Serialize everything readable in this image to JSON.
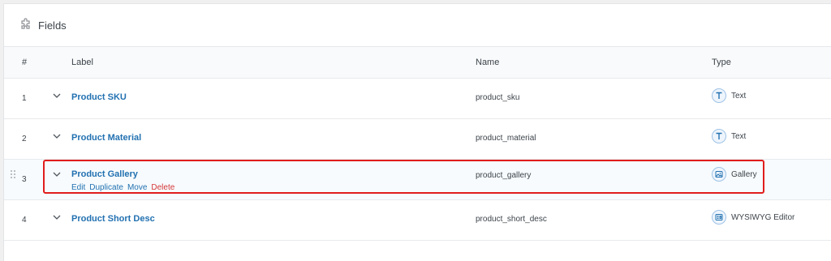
{
  "panel": {
    "title": "Fields",
    "icon": "puzzle-icon"
  },
  "table": {
    "columns": [
      "#",
      "Label",
      "Name",
      "Type"
    ],
    "rows": [
      {
        "num": "1",
        "label": "Product SKU",
        "name": "product_sku",
        "type": "Text",
        "type_icon": "text-type-icon"
      },
      {
        "num": "2",
        "label": "Product Material",
        "name": "product_material",
        "type": "Text",
        "type_icon": "text-type-icon"
      },
      {
        "num": "3",
        "label": "Product Gallery",
        "name": "product_gallery",
        "type": "Gallery",
        "type_icon": "gallery-type-icon",
        "actions": {
          "edit": "Edit",
          "duplicate": "Duplicate",
          "move": "Move",
          "delete": "Delete"
        }
      },
      {
        "num": "4",
        "label": "Product Short Desc",
        "name": "product_short_desc",
        "type": "WYSIWYG Editor",
        "type_icon": "editor-type-icon"
      }
    ]
  },
  "colors": {
    "link": "#2271b1",
    "delete": "#d63638",
    "highlight": "#e11d1d"
  }
}
